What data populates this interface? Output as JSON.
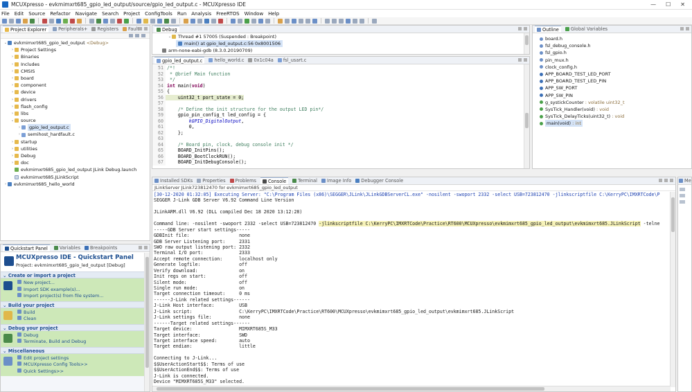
{
  "window": {
    "title": "MCUXpresso - evkmimxrt685_gpio_led_output/source/gpio_led_output.c - MCUXpresso IDE",
    "controls": [
      "—",
      "☐",
      "✕"
    ]
  },
  "menu": [
    "File",
    "Edit",
    "Source",
    "Refactor",
    "Navigate",
    "Search",
    "Project",
    "ConfigTools",
    "Run",
    "Analysis",
    "FreeRTOS",
    "Window",
    "Help"
  ],
  "project_explorer": {
    "tabs": [
      "Project Explorer",
      "Peripherals+",
      "Registers",
      "Faults"
    ],
    "items": [
      {
        "label": "evkmimxrt685_gpio_led_output",
        "suffix": "<Debug>",
        "indent": 0,
        "arrow": "⌄",
        "icon": "proj"
      },
      {
        "label": "Project Settings",
        "indent": 1,
        "arrow": "›",
        "icon": "folder"
      },
      {
        "label": "Binaries",
        "indent": 1,
        "arrow": "›",
        "icon": "folder"
      },
      {
        "label": "Includes",
        "indent": 1,
        "arrow": "›",
        "icon": "folder"
      },
      {
        "label": "CMSIS",
        "indent": 1,
        "arrow": "›",
        "icon": "folder"
      },
      {
        "label": "board",
        "indent": 1,
        "arrow": "›",
        "icon": "folder"
      },
      {
        "label": "component",
        "indent": 1,
        "arrow": "›",
        "icon": "folder"
      },
      {
        "label": "device",
        "indent": 1,
        "arrow": "›",
        "icon": "folder"
      },
      {
        "label": "drivers",
        "indent": 1,
        "arrow": "›",
        "icon": "folder"
      },
      {
        "label": "flash_config",
        "indent": 1,
        "arrow": "›",
        "icon": "folder"
      },
      {
        "label": "libs",
        "indent": 1,
        "arrow": "›",
        "icon": "folder"
      },
      {
        "label": "source",
        "indent": 1,
        "arrow": "⌄",
        "icon": "folder"
      },
      {
        "label": "gpio_led_output.c",
        "indent": 2,
        "arrow": "›",
        "icon": "cfile",
        "selected": true
      },
      {
        "label": "semihost_hardfault.c",
        "indent": 2,
        "arrow": "›",
        "icon": "cfile"
      },
      {
        "label": "startup",
        "indent": 1,
        "arrow": "›",
        "icon": "folder"
      },
      {
        "label": "utilities",
        "indent": 1,
        "arrow": "›",
        "icon": "folder"
      },
      {
        "label": "Debug",
        "indent": 1,
        "arrow": "›",
        "icon": "folder"
      },
      {
        "label": "doc",
        "indent": 1,
        "arrow": "›",
        "icon": "folder"
      },
      {
        "label": "evkmimxrt685_gpio_led_output JLink Debug.launch",
        "indent": 1,
        "arrow": "",
        "icon": "launch"
      },
      {
        "label": "evkmimxrt685.JLinkScript",
        "indent": 1,
        "arrow": "",
        "icon": "file"
      },
      {
        "label": "evkmimxrt685_hello_world",
        "indent": 0,
        "arrow": "›",
        "icon": "proj"
      }
    ]
  },
  "debug_view": {
    "tab": "Debug",
    "thread": "Thread #1 57005 (Suspended : Breakpoint)",
    "frame": "main() at gpio_led_output.c:56 0x8001506",
    "gdb": "arm-none-eabi-gdb (8.3.0.20190709)"
  },
  "editor": {
    "tabs": [
      "gpio_led_output.c",
      "hello_world.c",
      "0x1c04a",
      "fsl_usart.c"
    ],
    "lines": [
      {
        "n": "51",
        "parts": [
          [
            "cm",
            "/*!"
          ]
        ]
      },
      {
        "n": "52",
        "parts": [
          [
            "cm",
            " * @brief Main function"
          ]
        ]
      },
      {
        "n": "53",
        "parts": [
          [
            "cm",
            " */"
          ]
        ]
      },
      {
        "n": "54",
        "parts": [
          [
            "kw",
            "int"
          ],
          [
            "fn",
            " main("
          ],
          [
            "kw",
            "void"
          ],
          [
            "fn",
            ")"
          ]
        ]
      },
      {
        "n": "55",
        "parts": [
          [
            "fn",
            "{"
          ]
        ]
      },
      {
        "n": "56",
        "hl": true,
        "parts": [
          [
            "fn",
            "    uint32_t port_state = 0;"
          ]
        ]
      },
      {
        "n": "57",
        "parts": [
          [
            "fn",
            ""
          ]
        ]
      },
      {
        "n": "58",
        "parts": [
          [
            "cm",
            "    /* Define the init structure for the output LED pin*/"
          ]
        ]
      },
      {
        "n": "59",
        "parts": [
          [
            "fn",
            "    gpio_pin_config_t led_config = {"
          ]
        ]
      },
      {
        "n": "60",
        "parts": [
          [
            "it",
            "        kGPIO_DigitalOutput"
          ],
          [
            "fn",
            ","
          ]
        ]
      },
      {
        "n": "61",
        "parts": [
          [
            "fn",
            "        0,"
          ]
        ]
      },
      {
        "n": "62",
        "parts": [
          [
            "fn",
            "    };"
          ]
        ]
      },
      {
        "n": "63",
        "parts": [
          [
            "fn",
            ""
          ]
        ]
      },
      {
        "n": "64",
        "parts": [
          [
            "cm",
            "    /* Board pin, clock, debug console init */"
          ]
        ]
      },
      {
        "n": "65",
        "parts": [
          [
            "fn",
            "    BOARD_InitPins();"
          ]
        ]
      },
      {
        "n": "66",
        "parts": [
          [
            "fn",
            "    BOARD_BootClockRUN();"
          ]
        ]
      },
      {
        "n": "67",
        "parts": [
          [
            "fn",
            "    BOARD_InitDebugConsole();"
          ]
        ]
      }
    ]
  },
  "outline": {
    "tabs": [
      "Outline",
      "Global Variables"
    ],
    "items": [
      {
        "label": "board.h",
        "color": "#6b8fc7",
        "muted": ""
      },
      {
        "label": "fsl_debug_console.h",
        "color": "#6b8fc7",
        "muted": ""
      },
      {
        "label": "fsl_gpio.h",
        "color": "#6b8fc7",
        "muted": ""
      },
      {
        "label": "pin_mux.h",
        "color": "#6b8fc7",
        "muted": ""
      },
      {
        "label": "clock_config.h",
        "color": "#6b8fc7",
        "muted": ""
      },
      {
        "label": "APP_BOARD_TEST_LED_PORT",
        "color": "#3b6fb6",
        "muted": ""
      },
      {
        "label": "APP_BOARD_TEST_LED_PIN",
        "color": "#3b6fb6",
        "muted": ""
      },
      {
        "label": "APP_SW_PORT",
        "color": "#3b6fb6",
        "muted": ""
      },
      {
        "label": "APP_SW_PIN",
        "color": "#3b6fb6",
        "muted": ""
      },
      {
        "label": "g_systickCounter",
        "color": "#4aa04a",
        "muted": " : volatile uint32_t"
      },
      {
        "label": "SysTick_Handler(void)",
        "color": "#4aa04a",
        "muted": " : void"
      },
      {
        "label": "SysTick_DelayTicks(uint32_t)",
        "color": "#4aa04a",
        "muted": " : void"
      },
      {
        "label": "main(void)",
        "color": "#4aa04a",
        "muted": " : int",
        "selected": true
      }
    ]
  },
  "console": {
    "tabs": [
      "Installed SDKs",
      "Properties",
      "Problems",
      "Console",
      "Terminal",
      "Image Info",
      "Debugger Console"
    ],
    "header": "JLinkServer JLink723812470 for evkmimxrt685_gpio_led_output",
    "lines": [
      {
        "t": "[30-12-2020 01:32:05] Executing Server: \"C:\\Program Files (x86)\\SEGGER\\JLink\\JLinkGDBServerCL.exe\" -nosilent -swoport 2332 -select USB=723812470 -jlinkscriptfile C:\\KerryPC\\IMXRTCode\\P",
        "c": "blue"
      },
      {
        "t": "SEGGER J-Link GDB Server V6.92 Command Line Version"
      },
      {
        "t": ""
      },
      {
        "t": "JLinkARM.dll V6.92 (DLL compiled Dec 18 2020 13:12:28)"
      },
      {
        "t": ""
      },
      {
        "t": "Command line: -nosilent -swoport 2332 -select USB=723812470 ",
        "h": "-jlinkscriptfile C:\\KerryPC\\IMXRTCode\\Practice\\RT600\\MCUXpresso\\evkmimxrt685_gpio_led_output\\evkmimxrt685.JLinkScript",
        "t2": " -telne"
      },
      {
        "t": "-----GDB Server start settings-----"
      },
      {
        "t": "GDBInit file:                  none"
      },
      {
        "t": "GDB Server Listening port:     2331"
      },
      {
        "t": "SWO raw output listening port: 2332"
      },
      {
        "t": "Terminal I/O port:             2333"
      },
      {
        "t": "Accept remote connection:      localhost only"
      },
      {
        "t": "Generate logfile:              off"
      },
      {
        "t": "Verify download:               on"
      },
      {
        "t": "Init regs on start:            off"
      },
      {
        "t": "Silent mode:                   off"
      },
      {
        "t": "Single run mode:               on"
      },
      {
        "t": "Target connection timeout:     0 ms"
      },
      {
        "t": "------J-Link related settings------"
      },
      {
        "t": "J-Link Host interface:         USB"
      },
      {
        "t": "J-Link script:                 C:\\KerryPC\\IMXRTCode\\Practice\\RT600\\MCUXpresso\\evkmimxrt685_gpio_led_output\\evkmimxrt685.JLinkScript"
      },
      {
        "t": "J-Link settings file:          none"
      },
      {
        "t": "------Target related settings------"
      },
      {
        "t": "Target device:                 MIMXRT685S_M33"
      },
      {
        "t": "Target interface:              SWD"
      },
      {
        "t": "Target interface speed:        auto"
      },
      {
        "t": "Target endian:                 little"
      },
      {
        "t": ""
      },
      {
        "t": "Connecting to J-Link..."
      },
      {
        "t": "$$UserActionStart$$: Terms of use"
      },
      {
        "t": "$$UserActionEnd$$: Terms of use"
      },
      {
        "t": "J-Link is connected."
      },
      {
        "t": "Device \"MIMXRT685S_M33\" selected."
      }
    ]
  },
  "right_mini": {
    "tab": "Me"
  },
  "quickstart": {
    "tabs": [
      "Quickstart Panel",
      "Variables",
      "Breakpoints"
    ],
    "title": "MCUXpresso IDE - Quickstart Panel",
    "project": "Project: evkmimxrt685_gpio_led_output [Debug]",
    "sections": [
      {
        "title": "Create or import a project",
        "items": [
          "New project...",
          "Import SDK example(s)...",
          "Import project(s) from file system..."
        ]
      },
      {
        "title": "Build your project",
        "items": [
          "Build",
          "Clean"
        ]
      },
      {
        "title": "Debug your project",
        "items": [
          "Debug",
          "Terminate, Build and Debug"
        ]
      },
      {
        "title": "Miscellaneous",
        "items": [
          "Edit project settings",
          "MCUXpresso Config Tools>>",
          "Quick Settings>>"
        ]
      }
    ]
  },
  "colors": {
    "accent": "#1d4e8f",
    "green_panel": "#cde8b8",
    "code_highlight": "#e6edd0"
  }
}
